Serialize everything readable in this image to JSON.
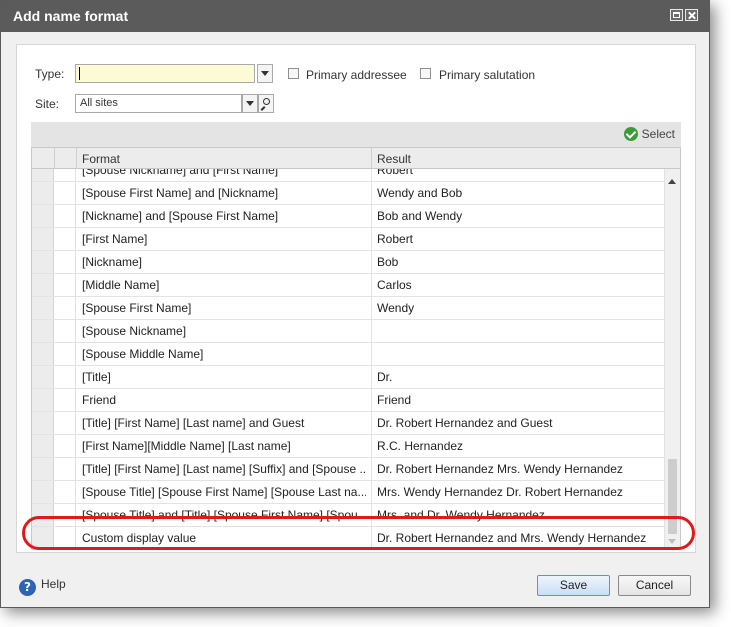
{
  "window": {
    "title": "Add name format"
  },
  "form": {
    "type_label": "Type:",
    "type_value": "",
    "primary_addressee_label": "Primary addressee",
    "primary_salutation_label": "Primary salutation",
    "site_label": "Site:",
    "site_value": "All sites"
  },
  "grid": {
    "select_label": "Select",
    "columns": [
      "Format",
      "Result"
    ],
    "rows": [
      {
        "format": "[Spouse Nickname] and [First Name]",
        "result": "Robert"
      },
      {
        "format": "[Spouse First Name] and [Nickname]",
        "result": "Wendy and Bob"
      },
      {
        "format": "[Nickname] and [Spouse First Name]",
        "result": "Bob and Wendy"
      },
      {
        "format": "[First Name]",
        "result": "Robert"
      },
      {
        "format": "[Nickname]",
        "result": "Bob"
      },
      {
        "format": "[Middle Name]",
        "result": "Carlos"
      },
      {
        "format": "[Spouse First Name]",
        "result": "Wendy"
      },
      {
        "format": "[Spouse Nickname]",
        "result": ""
      },
      {
        "format": "[Spouse Middle Name]",
        "result": ""
      },
      {
        "format": "[Title]",
        "result": "Dr."
      },
      {
        "format": "Friend",
        "result": "Friend"
      },
      {
        "format": "[Title] [First Name] [Last name] and Guest",
        "result": "Dr. Robert Hernandez and Guest"
      },
      {
        "format": "[First Name][Middle Name] [Last name]",
        "result": "R.C. Hernandez"
      },
      {
        "format": "[Title] [First Name] [Last name] [Suffix] and [Spouse ...",
        "result": "Dr. Robert Hernandez Mrs. Wendy Hernandez"
      },
      {
        "format": "[Spouse Title] [Spouse First Name] [Spouse Last na...",
        "result": "Mrs. Wendy Hernandez Dr. Robert Hernandez"
      },
      {
        "format": "[Spouse Title] and [Title] [Spouse First Name] [Spou...",
        "result": "Mrs. and Dr. Wendy Hernandez"
      },
      {
        "format": "Custom display value",
        "result": "Dr. Robert Hernandez and Mrs. Wendy Hernandez"
      }
    ]
  },
  "footer": {
    "help_label": "Help",
    "save_label": "Save",
    "cancel_label": "Cancel"
  },
  "colors": {
    "titlebar": "#5b5b5b",
    "highlight": "#e0191a",
    "type_input_bg": "#fdfbd5"
  }
}
